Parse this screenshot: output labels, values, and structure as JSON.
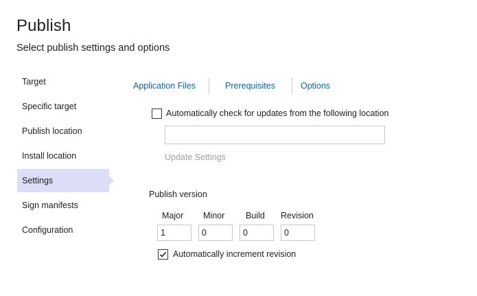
{
  "header": {
    "title": "Publish",
    "subtitle": "Select publish settings and options"
  },
  "sidebar": {
    "items": [
      {
        "label": "Target"
      },
      {
        "label": "Specific target"
      },
      {
        "label": "Publish location"
      },
      {
        "label": "Install location"
      },
      {
        "label": "Settings",
        "active": true
      },
      {
        "label": "Sign manifests"
      },
      {
        "label": "Configuration"
      }
    ]
  },
  "tabs": [
    {
      "label": "Application Files"
    },
    {
      "label": "Prerequisites"
    },
    {
      "label": "Options"
    }
  ],
  "updates": {
    "checkbox_label": "Automatically check for updates from the following location",
    "checked": false,
    "location_value": "",
    "settings_link": "Update Settings"
  },
  "publish_version": {
    "label": "Publish version",
    "fields": [
      {
        "label": "Major",
        "value": "1"
      },
      {
        "label": "Minor",
        "value": "0"
      },
      {
        "label": "Build",
        "value": "0"
      },
      {
        "label": "Revision",
        "value": "0"
      }
    ],
    "auto_increment_label": "Automatically increment revision",
    "auto_increment_checked": true
  },
  "colors": {
    "link": "#0e639c",
    "active_item_bg": "#dcdef8",
    "disabled_text": "#a0a0a0"
  }
}
